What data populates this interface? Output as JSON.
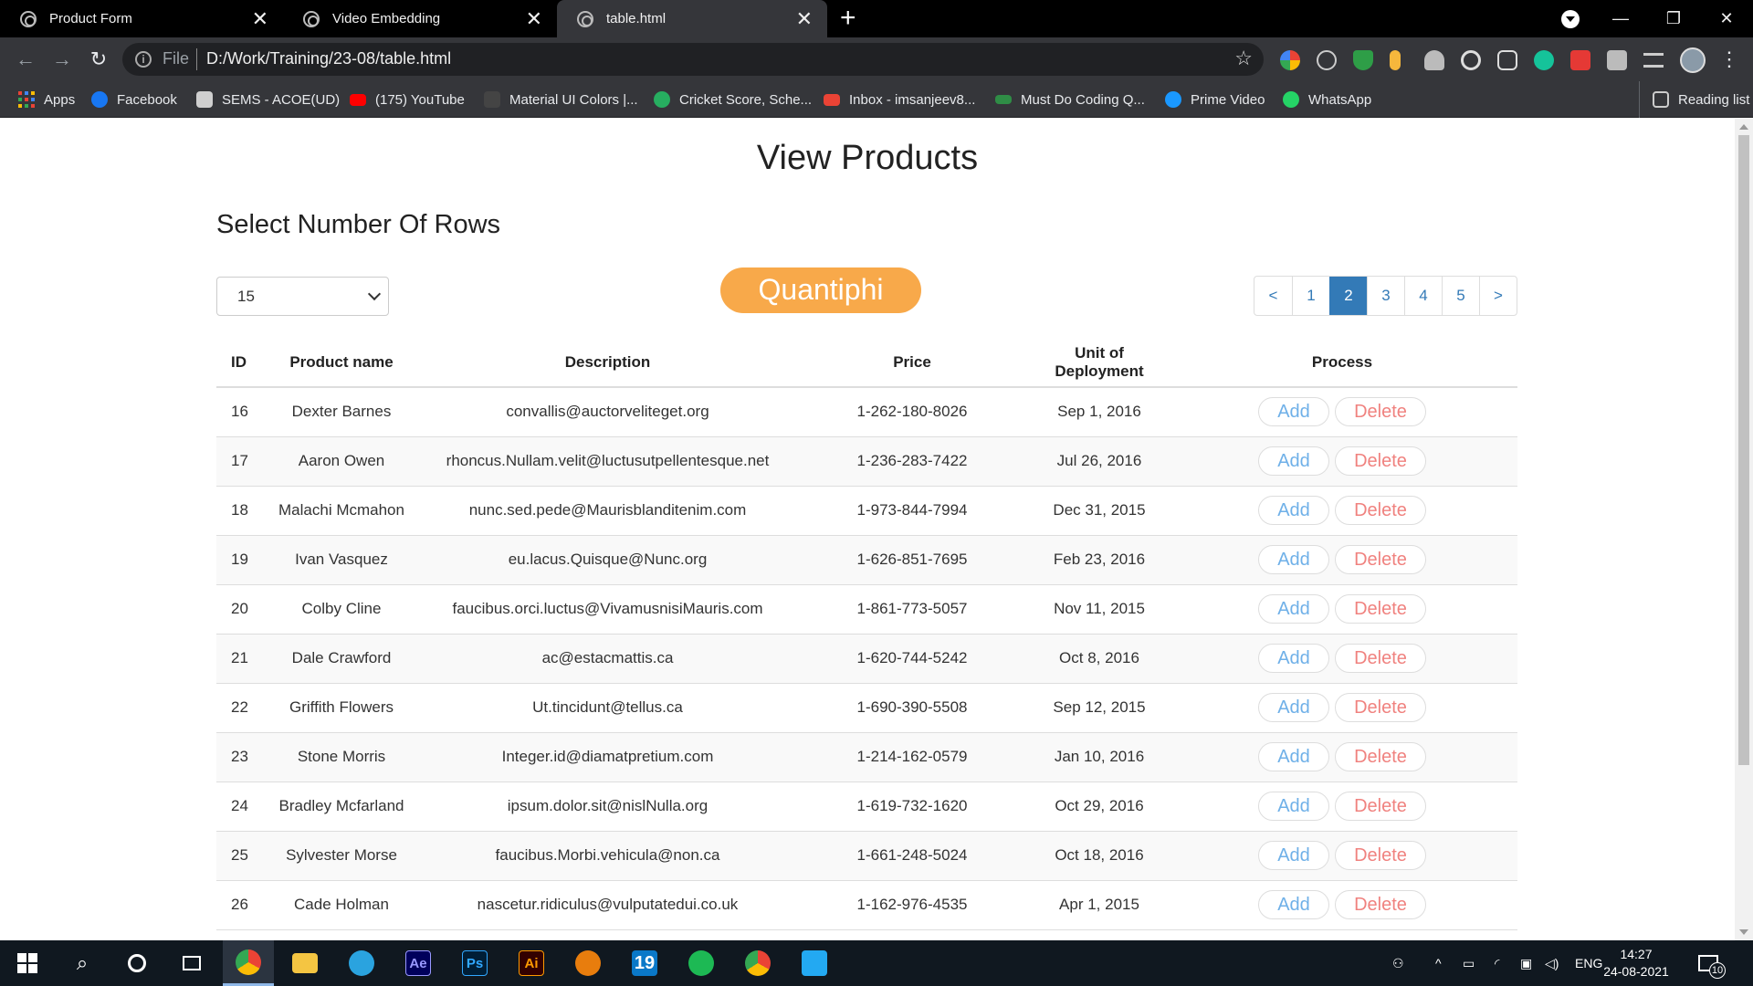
{
  "browser": {
    "tabs": [
      {
        "title": "Product Form"
      },
      {
        "title": "Video Embedding"
      },
      {
        "title": "table.html"
      }
    ],
    "new_tab": "+",
    "close_glyph": "✕",
    "address": {
      "scheme": "File",
      "url": "D:/Work/Training/23-08/table.html"
    },
    "bookmarks": [
      {
        "label": "Apps",
        "icon": "apps-grid-icon"
      },
      {
        "label": "Facebook",
        "icon": "facebook-icon",
        "color": "#1877f2"
      },
      {
        "label": "SEMS - ACOE(UD)",
        "icon": "sems-icon",
        "color": "#cfcfcf"
      },
      {
        "label": "(175) YouTube",
        "icon": "youtube-icon",
        "color": "#ff0000"
      },
      {
        "label": "Material UI Colors |...",
        "icon": "material-icon",
        "color": "#444444"
      },
      {
        "label": "Cricket Score, Sche...",
        "icon": "cricket-icon",
        "color": "#27ae60"
      },
      {
        "label": "Inbox - imsanjeev8...",
        "icon": "gmail-icon",
        "color": "#ea4335"
      },
      {
        "label": "Must Do Coding Q...",
        "icon": "gfg-icon",
        "color": "#2f8d46"
      },
      {
        "label": "Prime Video",
        "icon": "prime-video-icon",
        "color": "#1a98ff"
      },
      {
        "label": "WhatsApp",
        "icon": "whatsapp-icon",
        "color": "#25d366"
      }
    ],
    "reading_list": "Reading list"
  },
  "page": {
    "title": "View Products",
    "rows_label": "Select Number Of Rows",
    "rows_selected": "15",
    "brand": "Quantiphi",
    "pagination": {
      "prev": "<",
      "next": ">",
      "pages": [
        "1",
        "2",
        "3",
        "4",
        "5"
      ],
      "active": "2"
    },
    "table": {
      "headers": [
        "ID",
        "Product name",
        "Description",
        "Price",
        "Unit of Deployment",
        "Process"
      ],
      "add_label": "Add",
      "delete_label": "Delete",
      "rows": [
        {
          "id": "16",
          "name": "Dexter Barnes",
          "description": "convallis@auctorveliteget.org",
          "price": "1-262-180-8026",
          "date": "Sep 1, 2016"
        },
        {
          "id": "17",
          "name": "Aaron Owen",
          "description": "rhoncus.Nullam.velit@luctusutpellentesque.net",
          "price": "1-236-283-7422",
          "date": "Jul 26, 2016"
        },
        {
          "id": "18",
          "name": "Malachi Mcmahon",
          "description": "nunc.sed.pede@Maurisblanditenim.com",
          "price": "1-973-844-7994",
          "date": "Dec 31, 2015"
        },
        {
          "id": "19",
          "name": "Ivan Vasquez",
          "description": "eu.lacus.Quisque@Nunc.org",
          "price": "1-626-851-7695",
          "date": "Feb 23, 2016"
        },
        {
          "id": "20",
          "name": "Colby Cline",
          "description": "faucibus.orci.luctus@VivamusnisiMauris.com",
          "price": "1-861-773-5057",
          "date": "Nov 11, 2015"
        },
        {
          "id": "21",
          "name": "Dale Crawford",
          "description": "ac@estacmattis.ca",
          "price": "1-620-744-5242",
          "date": "Oct 8, 2016"
        },
        {
          "id": "22",
          "name": "Griffith Flowers",
          "description": "Ut.tincidunt@tellus.ca",
          "price": "1-690-390-5508",
          "date": "Sep 12, 2015"
        },
        {
          "id": "23",
          "name": "Stone Morris",
          "description": "Integer.id@diamatpretium.com",
          "price": "1-214-162-0579",
          "date": "Jan 10, 2016"
        },
        {
          "id": "24",
          "name": "Bradley Mcfarland",
          "description": "ipsum.dolor.sit@nislNulla.org",
          "price": "1-619-732-1620",
          "date": "Oct 29, 2016"
        },
        {
          "id": "25",
          "name": "Sylvester Morse",
          "description": "faucibus.Morbi.vehicula@non.ca",
          "price": "1-661-248-5024",
          "date": "Oct 18, 2016"
        },
        {
          "id": "26",
          "name": "Cade Holman",
          "description": "nascetur.ridiculus@vulputatedui.co.uk",
          "price": "1-162-976-4535",
          "date": "Apr 1, 2015"
        }
      ]
    }
  },
  "taskbar": {
    "apps": [
      {
        "icon": "windows-start-icon"
      },
      {
        "icon": "search-icon"
      },
      {
        "icon": "cortana-icon"
      },
      {
        "icon": "task-view-icon"
      },
      {
        "icon": "chrome-icon",
        "active": true
      },
      {
        "icon": "file-explorer-icon"
      },
      {
        "icon": "telegram-icon"
      },
      {
        "icon": "after-effects-icon",
        "label": "Ae",
        "color": "#9999ff",
        "bg": "#00005b"
      },
      {
        "icon": "photoshop-icon",
        "label": "Ps",
        "color": "#31a8ff",
        "bg": "#001e36"
      },
      {
        "icon": "illustrator-icon",
        "label": "Ai",
        "color": "#ff9a00",
        "bg": "#330000"
      },
      {
        "icon": "blender-icon"
      },
      {
        "icon": "app-19-icon",
        "label": "19",
        "color": "#ffffff",
        "bg": "#0a78c8"
      },
      {
        "icon": "spotify-icon"
      },
      {
        "icon": "chrome-profile-icon"
      },
      {
        "icon": "vscode-icon"
      }
    ],
    "language": "ENG",
    "time": "14:27",
    "date": "24-08-2021",
    "notifications": "10"
  }
}
